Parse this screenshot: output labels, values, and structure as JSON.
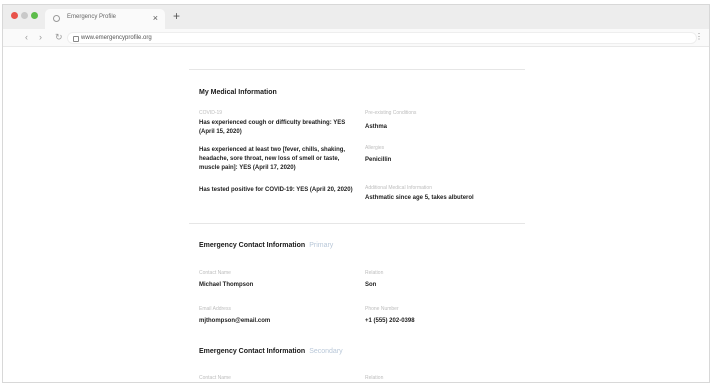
{
  "browser": {
    "tab_title": "Emergency Profile",
    "tab_close": "×",
    "new_tab": "+",
    "url": "www.emergencyprofile.org",
    "nav_back": "‹",
    "nav_forward": "›",
    "nav_reload": "↻",
    "menu": "⋮"
  },
  "medical": {
    "title": "My Medical Information",
    "covid_label": "COVID-19",
    "covid_items": [
      "Has experienced cough or difficulty breathing: YES (April 15, 2020)",
      "Has experienced at least two [fever, chills, shaking, headache, sore throat, new loss of smell or taste, muscle pain]: YES (April 17, 2020)",
      "Has tested positive for COVID-19: YES (April 20, 2020)"
    ],
    "conditions_label": "Pre-existing Conditions",
    "conditions_value": "Asthma",
    "allergies_label": "Allergies",
    "allergies_value": "Penicillin",
    "additional_label": "Additional Medical Information",
    "additional_value": "Asthmatic since age 5, takes albuterol"
  },
  "contact1": {
    "title": "Emergency Contact Information",
    "action": "Primary",
    "name_label": "Contact Name",
    "name_value": "Michael Thompson",
    "relation_label": "Relation",
    "relation_value": "Son",
    "email_label": "Email Address",
    "email_value": "mjthompson@email.com",
    "phone_label": "Phone Number",
    "phone_value": "+1 (555) 202-0398"
  },
  "contact2": {
    "title": "Emergency Contact Information",
    "action": "Secondary",
    "name_label": "Contact Name",
    "relation_label": "Relation"
  }
}
